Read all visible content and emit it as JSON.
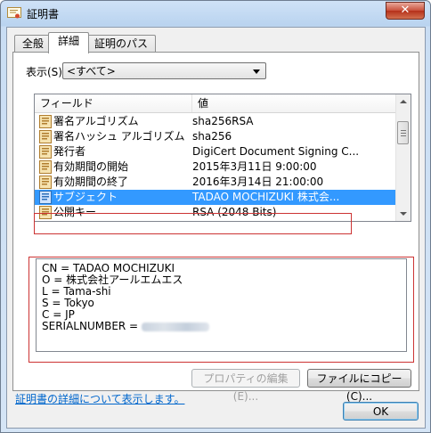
{
  "window": {
    "title": "証明書"
  },
  "tabs": [
    {
      "label": "全般"
    },
    {
      "label": "詳細"
    },
    {
      "label": "証明のパス"
    }
  ],
  "show": {
    "label": "表示(S):",
    "value": "<すべて>"
  },
  "list": {
    "columns": [
      "フィールド",
      "値"
    ],
    "rows": [
      {
        "field": "署名アルゴリズム",
        "value": "sha256RSA"
      },
      {
        "field": "署名ハッシュ アルゴリズム",
        "value": "sha256"
      },
      {
        "field": "発行者",
        "value": "DigiCert Document Signing C..."
      },
      {
        "field": "有効期間の開始",
        "value": "2015年3月11日 9:00:00"
      },
      {
        "field": "有効期間の終了",
        "value": "2016年3月14日 21:00:00"
      },
      {
        "field": "サブジェクト",
        "value": "TADAO MOCHIZUKI 株式会..."
      },
      {
        "field": "公開キー",
        "value": "RSA (2048 Bits)"
      }
    ],
    "selected_index": 5
  },
  "details": [
    "CN = TADAO MOCHIZUKI",
    "O = 株式会社アールエムエス",
    "L = Tama-shi",
    "S = Tokyo",
    "C = JP",
    "SERIALNUMBER = "
  ],
  "buttons": {
    "edit_properties": "プロパティの編集(E)...",
    "copy_to_file": "ファイルにコピー(C)...",
    "ok": "OK"
  },
  "link": "証明書の詳細について表示します。",
  "colors": {
    "selection": "#3399ff",
    "highlight_box": "#cc3333",
    "link": "#0066cc"
  }
}
